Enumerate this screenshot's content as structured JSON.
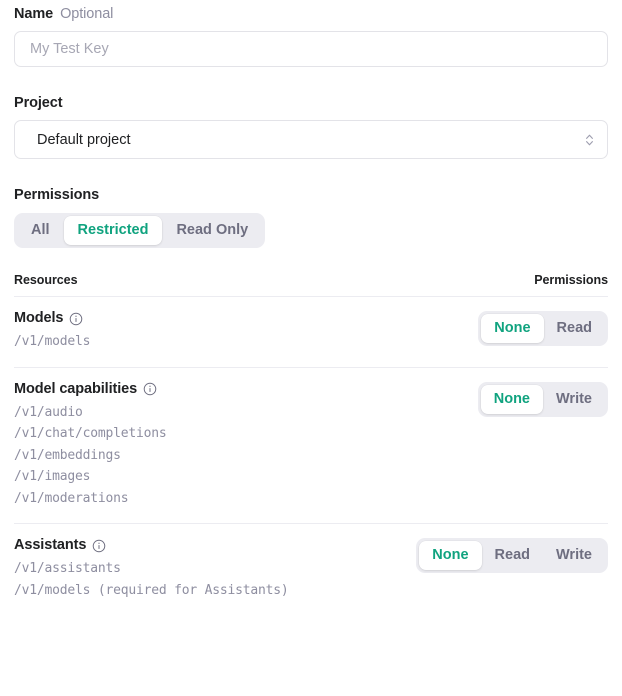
{
  "form": {
    "name_field": {
      "label": "Name",
      "optional_tag": "Optional",
      "placeholder": "My Test Key",
      "value": ""
    },
    "project_field": {
      "label": "Project",
      "selected": "Default project",
      "chevron_icon": "chevron-up-down-icon"
    },
    "permissions_field": {
      "label": "Permissions",
      "options": [
        {
          "label": "All",
          "selected": false
        },
        {
          "label": "Restricted",
          "selected": true
        },
        {
          "label": "Read Only",
          "selected": false
        }
      ]
    }
  },
  "resources_table": {
    "headers": {
      "resources": "Resources",
      "permissions": "Permissions"
    },
    "rows": [
      {
        "title": "Models",
        "info_icon": "info-icon",
        "endpoints": [
          "/v1/models"
        ],
        "options": [
          {
            "label": "None",
            "selected": true
          },
          {
            "label": "Read",
            "selected": false
          }
        ]
      },
      {
        "title": "Model capabilities",
        "info_icon": "info-icon",
        "endpoints": [
          "/v1/audio",
          "/v1/chat/completions",
          "/v1/embeddings",
          "/v1/images",
          "/v1/moderations"
        ],
        "options": [
          {
            "label": "None",
            "selected": true
          },
          {
            "label": "Write",
            "selected": false
          }
        ]
      },
      {
        "title": "Assistants",
        "info_icon": "info-icon",
        "endpoints": [
          "/v1/assistants",
          "/v1/models (required for Assistants)"
        ],
        "options": [
          {
            "label": "None",
            "selected": true
          },
          {
            "label": "Read",
            "selected": false
          },
          {
            "label": "Write",
            "selected": false
          }
        ]
      }
    ]
  },
  "colors": {
    "accent_green": "#10a37f",
    "track_gray": "#ececf1",
    "muted_text": "#8e8ea0",
    "border": "#e3e3e8"
  }
}
